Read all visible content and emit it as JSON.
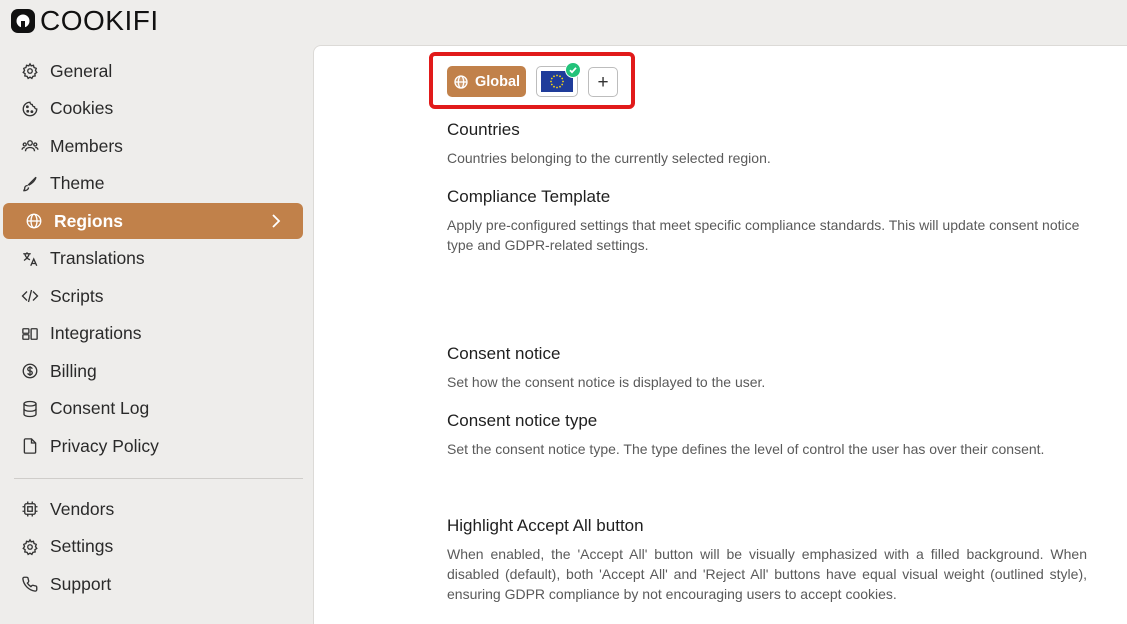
{
  "brand": {
    "name": "COOKIFI",
    "accent": "#c1814a"
  },
  "sidebar": {
    "items": [
      {
        "label": "General",
        "icon": "gear-icon"
      },
      {
        "label": "Cookies",
        "icon": "cookie-icon"
      },
      {
        "label": "Members",
        "icon": "users-icon"
      },
      {
        "label": "Theme",
        "icon": "brush-icon"
      },
      {
        "label": "Regions",
        "icon": "globe-icon",
        "active": true
      },
      {
        "label": "Translations",
        "icon": "translate-icon"
      },
      {
        "label": "Scripts",
        "icon": "code-icon"
      },
      {
        "label": "Integrations",
        "icon": "integrations-icon"
      },
      {
        "label": "Billing",
        "icon": "dollar-icon"
      },
      {
        "label": "Consent Log",
        "icon": "database-icon"
      },
      {
        "label": "Privacy Policy",
        "icon": "document-icon"
      }
    ],
    "secondary": [
      {
        "label": "Vendors",
        "icon": "chip-icon"
      },
      {
        "label": "Settings",
        "icon": "gear-icon"
      },
      {
        "label": "Support",
        "icon": "phone-icon"
      }
    ]
  },
  "regions": {
    "global_label": "Global",
    "add_label": "+"
  },
  "sections": {
    "countries": {
      "title": "Countries",
      "desc": "Countries belonging to the currently selected region."
    },
    "compliance": {
      "title": "Compliance Template",
      "desc": "Apply pre-configured settings that meet specific compliance standards. This will update consent notice type and GDPR-related settings."
    },
    "consent_notice": {
      "title": "Consent notice",
      "desc": "Set how the consent notice is displayed to the user."
    },
    "notice_type": {
      "title": "Consent notice type",
      "desc": "Set the consent notice type. The type defines the level of control the user has over their consent."
    },
    "highlight": {
      "title": "Highlight Accept All button",
      "desc": "When enabled, the 'Accept All' button will be visually emphasized with a filled background. When disabled (default), both 'Accept All' and 'Reject All' buttons have equal visual weight (outlined style), ensuring GDPR compliance by not encouraging users to accept cookies."
    }
  }
}
